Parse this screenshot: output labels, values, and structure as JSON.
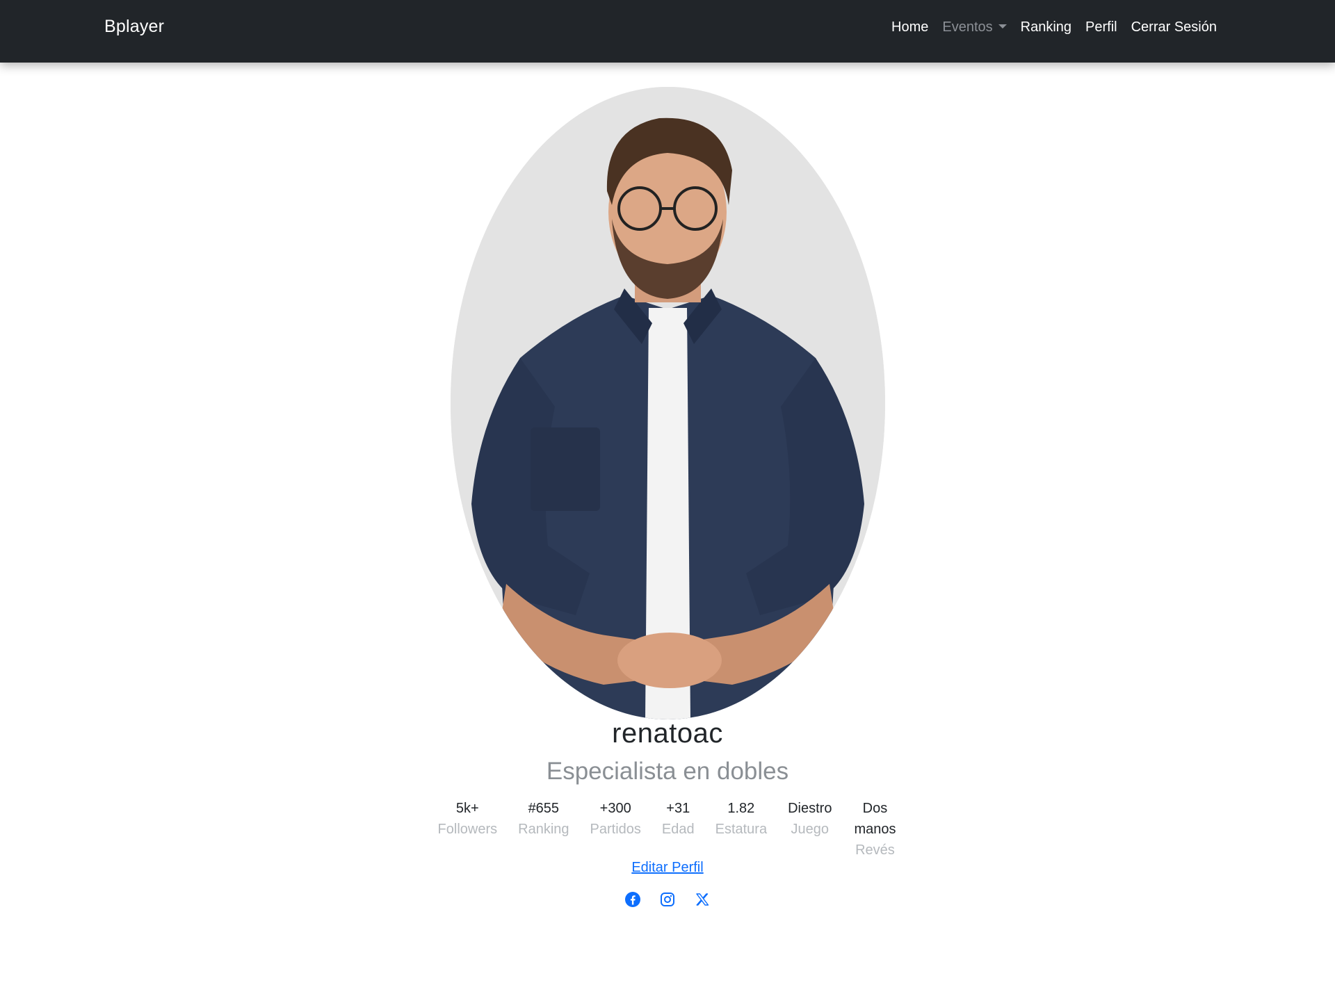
{
  "navbar": {
    "brand": "Bplayer",
    "items": [
      {
        "label": "Home"
      },
      {
        "label": "Eventos"
      },
      {
        "label": "Ranking"
      },
      {
        "label": "Perfil"
      },
      {
        "label": "Cerrar Sesión"
      }
    ]
  },
  "profile": {
    "photo_alt": "profile-photo",
    "username": "renatoac",
    "tagline": "Especialista en dobles",
    "stats": [
      {
        "value": "5k+",
        "label": "Followers"
      },
      {
        "value": "#655",
        "label": "Ranking"
      },
      {
        "value": "+300",
        "label": "Partidos"
      },
      {
        "value": "+31",
        "label": "Edad"
      },
      {
        "value": "1.82",
        "label": "Estatura"
      },
      {
        "value": "Diestro",
        "label": "Juego"
      },
      {
        "value": "Dos manos",
        "label": "Revés"
      }
    ],
    "edit_label": "Editar Perfil",
    "socials": [
      {
        "icon": "facebook-icon"
      },
      {
        "icon": "instagram-icon"
      },
      {
        "icon": "x-twitter-icon"
      }
    ]
  },
  "colors": {
    "navbar_bg": "#212529",
    "link_blue": "#0d6efd",
    "muted_text": "#b5b9bd",
    "photo_bg": "#e3e3e3"
  }
}
